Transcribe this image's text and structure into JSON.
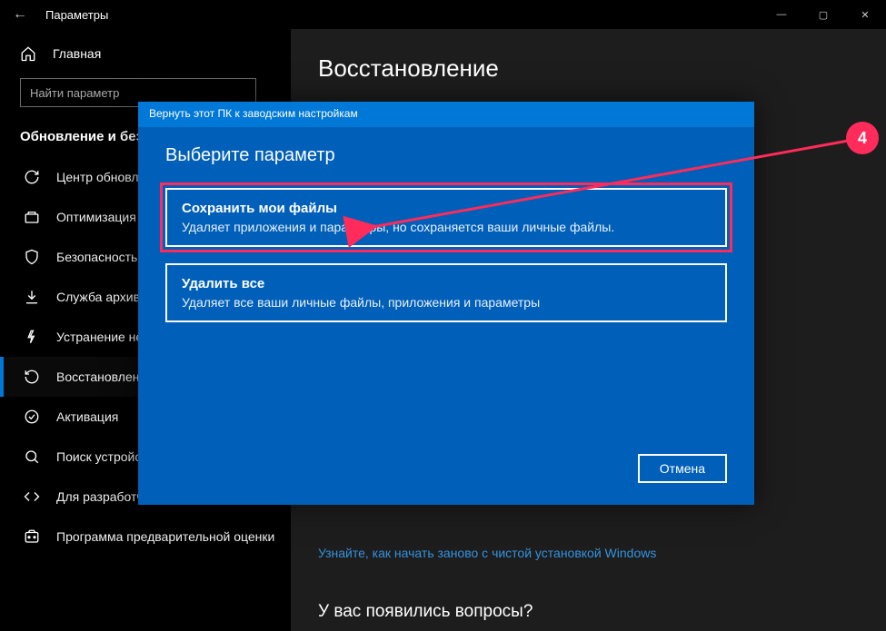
{
  "window": {
    "title": "Параметры",
    "back": "←",
    "minimize": "—",
    "maximize": "▢",
    "close": "✕"
  },
  "sidebar": {
    "home_label": "Главная",
    "search_placeholder": "Найти параметр",
    "section_title": "Обновление и безопасность",
    "items": [
      {
        "label": "Центр обновления Windows"
      },
      {
        "label": "Оптимизация доставки"
      },
      {
        "label": "Безопасность Windows"
      },
      {
        "label": "Служба архивации"
      },
      {
        "label": "Устранение неполадок"
      },
      {
        "label": "Восстановление"
      },
      {
        "label": "Активация"
      },
      {
        "label": "Поиск устройства"
      },
      {
        "label": "Для разработчиков"
      },
      {
        "label": "Программа предварительной оценки Windows"
      }
    ]
  },
  "main": {
    "page_title": "Восстановление",
    "link": "Узнайте, как начать заново с чистой установкой Windows",
    "questions": "У вас появились вопросы?"
  },
  "dialog": {
    "header": "Вернуть этот ПК к заводским настройкам",
    "title": "Выберите параметр",
    "options": [
      {
        "title": "Сохранить мои файлы",
        "desc": "Удаляет приложения и параметры, но сохраняется ваши личные файлы."
      },
      {
        "title": "Удалить все",
        "desc": "Удаляет все ваши личные файлы, приложения и параметры"
      }
    ],
    "cancel": "Отмена"
  },
  "annotation": {
    "step": "4"
  }
}
